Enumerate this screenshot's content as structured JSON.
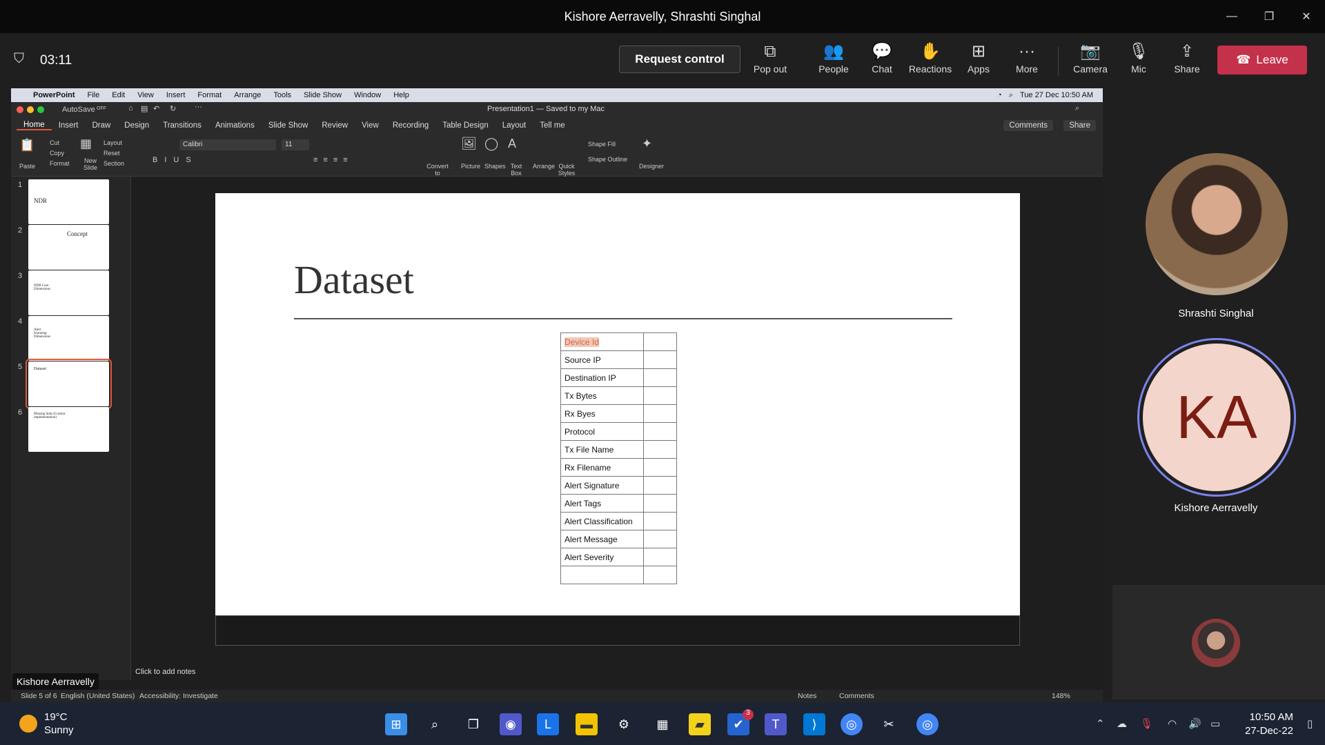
{
  "window": {
    "title": "Kishore Aerravelly, Shrashti Singhal",
    "controls": [
      "—",
      "❐",
      "✕"
    ]
  },
  "meeting": {
    "timer": "03:11",
    "request_control": "Request control",
    "buttons": [
      {
        "label": "Pop out",
        "icon": "pop-out-icon"
      },
      {
        "label": "People",
        "icon": "people-icon"
      },
      {
        "label": "Chat",
        "icon": "chat-icon"
      },
      {
        "label": "Reactions",
        "icon": "reactions-icon"
      },
      {
        "label": "Apps",
        "icon": "apps-icon"
      },
      {
        "label": "More",
        "icon": "more-icon"
      },
      {
        "label": "Camera",
        "icon": "camera-off-icon"
      },
      {
        "label": "Mic",
        "icon": "mic-icon"
      },
      {
        "label": "Share",
        "icon": "share-icon"
      }
    ],
    "leave": "Leave",
    "leave_color": "#c4314b"
  },
  "mac_menu": {
    "app": "PowerPoint",
    "items": [
      "File",
      "Edit",
      "View",
      "Insert",
      "Format",
      "Arrange",
      "Tools",
      "Slide Show",
      "Window",
      "Help"
    ],
    "status": "Tue 27 Dec  10:50 AM"
  },
  "ppt": {
    "autosave": "AutoSave",
    "autosave_state": "OFF",
    "doc_title": "Presentation1 — Saved to my Mac",
    "tabs": [
      "Home",
      "Insert",
      "Draw",
      "Design",
      "Transitions",
      "Animations",
      "Slide Show",
      "Review",
      "View",
      "Recording",
      "Table Design",
      "Layout"
    ],
    "tell_me": "Tell me",
    "comments": "Comments",
    "share": "Share",
    "ribbon": {
      "paste": "Paste",
      "cut": "Cut",
      "copy": "Copy",
      "format": "Format",
      "new_slide": "New Slide",
      "layout": "Layout",
      "reset": "Reset",
      "section": "Section",
      "font": "Calibri",
      "size": "11",
      "convert": "Convert to SmartArt",
      "picture": "Picture",
      "shapes": "Shapes",
      "textbox": "Text Box",
      "arrange": "Arrange",
      "quick_styles": "Quick Styles",
      "shape_fill": "Shape Fill",
      "shape_outline": "Shape Outline",
      "designer": "Designer"
    },
    "slides": [
      {
        "num": "1",
        "title": "NDR"
      },
      {
        "num": "2",
        "title": "Concept"
      },
      {
        "num": "3",
        "title": "NDR Core Dimensions"
      },
      {
        "num": "4",
        "title": "Alert Scanning Dimensions"
      },
      {
        "num": "5",
        "title": "Dataset"
      },
      {
        "num": "6",
        "title": "Missing links (Current implementation)"
      }
    ],
    "slide": {
      "title": "Dataset",
      "table_rows": [
        "Device Id",
        "Source IP",
        "Destination IP",
        "Tx Bytes",
        "Rx Byes",
        "Protocol",
        "Tx File Name",
        "Rx Filename",
        "Alert Signature",
        "Alert Tags",
        "Alert Classification",
        "Alert Message",
        "Alert Severity",
        ""
      ]
    },
    "notes_placeholder": "Click to add notes",
    "status": {
      "slide": "Slide 5 of 6",
      "language": "English (United States)",
      "accessibility": "Accessibility: Investigate",
      "notes": "Notes",
      "comments": "Comments",
      "zoom": "148%"
    }
  },
  "presenter_badge": "Kishore Aerravelly",
  "participants": [
    {
      "name": "Shrashti Singhal"
    },
    {
      "name": "Kishore Aerravelly",
      "initials": "KA"
    }
  ],
  "taskbar": {
    "weather_temp": "19°C",
    "weather_desc": "Sunny",
    "badge_count": "3",
    "time": "10:50 AM",
    "date": "27-Dec-22"
  }
}
